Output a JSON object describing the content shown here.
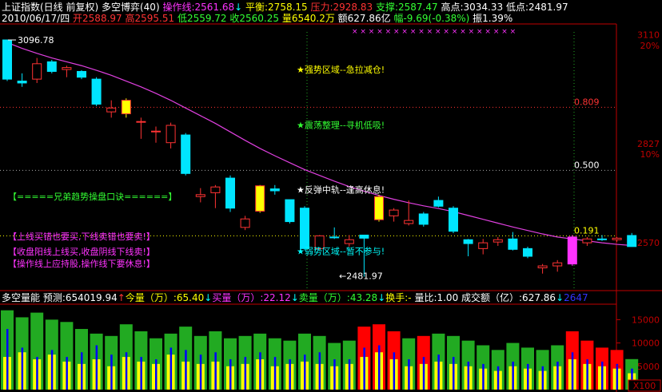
{
  "colors": {
    "bg": "#000000",
    "up": "#ff3333",
    "down": "#00e5ff",
    "ma": "#e040e0",
    "text_white": "#ffffff",
    "text_yellow": "#ffff00",
    "text_green": "#33ff33",
    "text_magenta": "#ff33ff",
    "text_cyan": "#00ffff",
    "text_red": "#ff3333",
    "axis_red": "#c00000",
    "vol_green": "#22aa22",
    "vol_red": "#ff0000",
    "vol_yellow": "#ffff00",
    "vol_blue": "#0000ff"
  },
  "header": {
    "line1": [
      {
        "text": "上证指数(日线 前复权) 多空博弈(40)",
        "color": "#ffffff"
      },
      {
        "text": " 操作线:2561.68",
        "color": "#ff33ff"
      },
      {
        "text": "↓",
        "color": "#00ffff"
      },
      {
        "text": " 平衡:2758.15",
        "color": "#ffff00"
      },
      {
        "text": " 压力:2928.83",
        "color": "#ff3333"
      },
      {
        "text": " 支撑:2587.47",
        "color": "#33ff33"
      },
      {
        "text": " 高点:3034.33",
        "color": "#ffffff"
      },
      {
        "text": " 低点:2481.97",
        "color": "#ffffff"
      }
    ],
    "line2": [
      {
        "text": "2010/06/17/四",
        "color": "#ffffff"
      },
      {
        "text": " 开2588.97",
        "color": "#ff3333"
      },
      {
        "text": " 高2595.51",
        "color": "#ff3333"
      },
      {
        "text": " 低2559.72",
        "color": "#33ff33"
      },
      {
        "text": " 收2560.25",
        "color": "#33ff33"
      },
      {
        "text": " 量6540.2万",
        "color": "#ffff00"
      },
      {
        "text": " 额627.86亿",
        "color": "#ffffff"
      },
      {
        "text": " 幅-9.69(-0.38%)",
        "color": "#33ff33"
      },
      {
        "text": " 振1.39%",
        "color": "#ffffff"
      }
    ]
  },
  "price_axis": {
    "labels": [
      {
        "text": "3110",
        "price": 3110,
        "color": "#c00000"
      },
      {
        "text": "20%",
        "price": 3082,
        "color": "#c00000"
      },
      {
        "text": "2827",
        "price": 2827,
        "color": "#c00000"
      },
      {
        "text": "10%",
        "price": 2800,
        "color": "#c00000"
      },
      {
        "text": "2570",
        "price": 2570,
        "color": "#c00000"
      }
    ]
  },
  "chart_data": {
    "type": "candlestick",
    "title": "上证指数(日线 前复权)",
    "ylim": [
      2450,
      3130
    ],
    "candles": [
      {
        "o": 3096.78,
        "h": 3096.78,
        "l": 2990,
        "c": 2995
      },
      {
        "o": 2990,
        "h": 3010,
        "l": 2975,
        "c": 2985
      },
      {
        "o": 2995,
        "h": 3050,
        "l": 2985,
        "c": 3035
      },
      {
        "o": 3040,
        "h": 3045,
        "l": 3010,
        "c": 3015
      },
      {
        "o": 3020,
        "h": 3030,
        "l": 3000,
        "c": 3025
      },
      {
        "o": 3015,
        "h": 3018,
        "l": 2995,
        "c": 3000
      },
      {
        "o": 2995,
        "h": 3000,
        "l": 2925,
        "c": 2930
      },
      {
        "o": 2910,
        "h": 2940,
        "l": 2895,
        "c": 2920
      },
      {
        "o": 2940,
        "h": 2945,
        "l": 2895,
        "c": 2905
      },
      {
        "o": 2885,
        "h": 2895,
        "l": 2840,
        "c": 2885
      },
      {
        "o": 2860,
        "h": 2872,
        "l": 2830,
        "c": 2860
      },
      {
        "o": 2830,
        "h": 2882,
        "l": 2815,
        "c": 2875
      },
      {
        "o": 2850,
        "h": 2855,
        "l": 2745,
        "c": 2750
      },
      {
        "o": 2690,
        "h": 2712,
        "l": 2675,
        "c": 2695
      },
      {
        "o": 2700,
        "h": 2720,
        "l": 2660,
        "c": 2715
      },
      {
        "o": 2738,
        "h": 2745,
        "l": 2650,
        "c": 2660
      },
      {
        "o": 2610,
        "h": 2640,
        "l": 2603,
        "c": 2632
      },
      {
        "o": 2652,
        "h": 2720,
        "l": 2648,
        "c": 2718
      },
      {
        "o": 2710,
        "h": 2720,
        "l": 2695,
        "c": 2705
      },
      {
        "o": 2682,
        "h": 2682,
        "l": 2620,
        "c": 2625
      },
      {
        "o": 2660,
        "h": 2665,
        "l": 2550,
        "c": 2555
      },
      {
        "o": 2555,
        "h": 2590,
        "l": 2552,
        "c": 2588
      },
      {
        "o": 2585,
        "h": 2610,
        "l": 2580,
        "c": 2583
      },
      {
        "o": 2568,
        "h": 2590,
        "l": 2560,
        "c": 2578
      },
      {
        "o": 2590,
        "h": 2590,
        "l": 2481.97,
        "c": 2582
      },
      {
        "o": 2630,
        "h": 2695,
        "l": 2625,
        "c": 2690
      },
      {
        "o": 2640,
        "h": 2660,
        "l": 2625,
        "c": 2655
      },
      {
        "o": 2620,
        "h": 2680,
        "l": 2615,
        "c": 2628
      },
      {
        "o": 2645,
        "h": 2650,
        "l": 2612,
        "c": 2618
      },
      {
        "o": 2680,
        "h": 2690,
        "l": 2662,
        "c": 2665
      },
      {
        "o": 2660,
        "h": 2665,
        "l": 2595,
        "c": 2600
      },
      {
        "o": 2578,
        "h": 2580,
        "l": 2535,
        "c": 2568
      },
      {
        "o": 2555,
        "h": 2580,
        "l": 2540,
        "c": 2570
      },
      {
        "o": 2572,
        "h": 2585,
        "l": 2562,
        "c": 2578
      },
      {
        "o": 2580,
        "h": 2598,
        "l": 2550,
        "c": 2553
      },
      {
        "o": 2555,
        "h": 2560,
        "l": 2530,
        "c": 2535
      },
      {
        "o": 2505,
        "h": 2515,
        "l": 2490,
        "c": 2510
      },
      {
        "o": 2510,
        "h": 2525,
        "l": 2495,
        "c": 2518
      },
      {
        "o": 2515,
        "h": 2590,
        "l": 2510,
        "c": 2585
      },
      {
        "o": 2570,
        "h": 2585,
        "l": 2562,
        "c": 2580
      },
      {
        "o": 2580,
        "h": 2590,
        "l": 2575,
        "c": 2578
      },
      {
        "o": 2578,
        "h": 2585,
        "l": 2572,
        "c": 2582
      },
      {
        "o": 2588.97,
        "h": 2595.51,
        "l": 2559.72,
        "c": 2560.25
      }
    ],
    "special": {
      "8": "#ffff00",
      "17": "#ffff00",
      "25": "#ffff00",
      "38": "#ff33ff"
    },
    "ma_line": [
      3090,
      3075,
      3062,
      3050,
      3040,
      3030,
      3018,
      3005,
      2990,
      2975,
      2958,
      2940,
      2920,
      2900,
      2880,
      2858,
      2836,
      2815,
      2796,
      2778,
      2760,
      2745,
      2730,
      2716,
      2704,
      2693,
      2683,
      2674,
      2666,
      2659,
      2651,
      2641,
      2631,
      2621,
      2611,
      2602,
      2593,
      2585,
      2580,
      2575,
      2570,
      2566,
      2563
    ],
    "high_label": "3096.78",
    "low_label": "←2481.97",
    "fib_lines": [
      {
        "label": "0.809",
        "price": 2922,
        "color": "#ff3333"
      },
      {
        "label": "0.500",
        "price": 2758,
        "color": "#ffffff"
      },
      {
        "label": "0.191",
        "price": 2588,
        "color": "#ffff00"
      }
    ],
    "zone_labels": [
      {
        "text": "★强势区域--急拉减仓!",
        "price": 3012,
        "color": "#ffff00"
      },
      {
        "text": "★震荡整理--寻机低吸!",
        "price": 2868,
        "color": "#33ff33"
      },
      {
        "text": "★反弹中轨--逢高休息!",
        "price": 2700,
        "color": "#ffffff"
      },
      {
        "text": "★弱势区域--暂不参与!",
        "price": 2540,
        "color": "#00ffff"
      }
    ],
    "mnemonics": [
      {
        "text": "【=====兄弟趋势操盘口诀======】",
        "color": "#33ff33"
      },
      {
        "text": "【上线买错也要买,下线卖错也要卖!】",
        "color": "#ff33ff"
      },
      {
        "text": "【收盘阳线上线买,收盘阴线下线卖!】",
        "color": "#ff33ff"
      },
      {
        "text": "【操作线上应持股,操作线下要休息!】",
        "color": "#ff33ff"
      }
    ],
    "top_marks": "× × × × × × × × × × × × × × × × × × × ×"
  },
  "volume_panel": {
    "header": [
      {
        "text": "多空量能",
        "color": "#ffffff"
      },
      {
        "text": " 预测:654019.94",
        "color": "#ffffff"
      },
      {
        "text": "↑",
        "color": "#ff3333"
      },
      {
        "text": "今量（万）:65.40",
        "color": "#ffff00"
      },
      {
        "text": "↓",
        "color": "#00ffff"
      },
      {
        "text": "买量（万）:22.12",
        "color": "#ff33ff"
      },
      {
        "text": "↓",
        "color": "#00ffff"
      },
      {
        "text": "卖量（万）:43.28",
        "color": "#33ff33"
      },
      {
        "text": "↓",
        "color": "#00ffff"
      },
      {
        "text": "换手:-",
        "color": "#ffff00"
      },
      {
        "text": " 量比:1.00",
        "color": "#ffffff"
      },
      {
        "text": " 成交额（亿）:627.86",
        "color": "#ffffff"
      },
      {
        "text": "↓",
        "color": "#00ffff"
      },
      {
        "text": "2647",
        "color": "#3333ff"
      }
    ],
    "axis_labels": [
      {
        "text": "15000",
        "value": 15000
      },
      {
        "text": "10000",
        "value": 10000
      },
      {
        "text": "5000",
        "value": 5000
      }
    ],
    "unit": "X100",
    "ymax": 17800,
    "volumes": [
      {
        "v": 17000,
        "c": "green",
        "y": 7000,
        "b": 13000
      },
      {
        "v": 15500,
        "c": "green",
        "y": 8000,
        "b": 9000
      },
      {
        "v": 16500,
        "c": "green",
        "y": 6500,
        "b": 7000
      },
      {
        "v": 15000,
        "c": "green",
        "y": 7500,
        "b": 8500
      },
      {
        "v": 14500,
        "c": "green",
        "y": 6000,
        "b": 7000
      },
      {
        "v": 13000,
        "c": "green",
        "y": 5500,
        "b": 8000
      },
      {
        "v": 12000,
        "c": "green",
        "y": 6500,
        "b": 9500
      },
      {
        "v": 11500,
        "c": "green",
        "y": 5000,
        "b": 7500
      },
      {
        "v": 14000,
        "c": "green",
        "y": 7000,
        "b": 8000
      },
      {
        "v": 12500,
        "c": "green",
        "y": 6000,
        "b": 7000
      },
      {
        "v": 11000,
        "c": "green",
        "y": 5500,
        "b": 6500
      },
      {
        "v": 12000,
        "c": "green",
        "y": 7500,
        "b": 9000
      },
      {
        "v": 13500,
        "c": "green",
        "y": 6000,
        "b": 8500
      },
      {
        "v": 11500,
        "c": "green",
        "y": 5500,
        "b": 7500
      },
      {
        "v": 12500,
        "c": "green",
        "y": 6000,
        "b": 8000
      },
      {
        "v": 11000,
        "c": "green",
        "y": 5000,
        "b": 6500
      },
      {
        "v": 11500,
        "c": "green",
        "y": 5500,
        "b": 7000
      },
      {
        "v": 12000,
        "c": "green",
        "y": 6500,
        "b": 8000
      },
      {
        "v": 11000,
        "c": "green",
        "y": 5000,
        "b": 7000
      },
      {
        "v": 10500,
        "c": "green",
        "y": 5500,
        "b": 6500
      },
      {
        "v": 12000,
        "c": "green",
        "y": 6000,
        "b": 7500
      },
      {
        "v": 11500,
        "c": "green",
        "y": 5500,
        "b": 8000
      },
      {
        "v": 10000,
        "c": "green",
        "y": 5000,
        "b": 6500
      },
      {
        "v": 10500,
        "c": "green",
        "y": 5500,
        "b": 6500
      },
      {
        "v": 13500,
        "c": "red",
        "y": 7000,
        "b": 9000
      },
      {
        "v": 14000,
        "c": "red",
        "y": 8000,
        "b": 9500
      },
      {
        "v": 12500,
        "c": "red",
        "y": 6500,
        "b": 8000
      },
      {
        "v": 11000,
        "c": "green",
        "y": 5000,
        "b": 6500
      },
      {
        "v": 11500,
        "c": "red",
        "y": 5500,
        "b": 7000
      },
      {
        "v": 12000,
        "c": "green",
        "y": 6000,
        "b": 7500
      },
      {
        "v": 11500,
        "c": "green",
        "y": 5500,
        "b": 7000
      },
      {
        "v": 10500,
        "c": "green",
        "y": 5000,
        "b": 6000
      },
      {
        "v": 9500,
        "c": "green",
        "y": 4500,
        "b": 5500
      },
      {
        "v": 8500,
        "c": "green",
        "y": 4000,
        "b": 5000
      },
      {
        "v": 10000,
        "c": "green",
        "y": 5000,
        "b": 6000
      },
      {
        "v": 9000,
        "c": "green",
        "y": 4500,
        "b": 5500
      },
      {
        "v": 8500,
        "c": "green",
        "y": 4000,
        "b": 5000
      },
      {
        "v": 9500,
        "c": "green",
        "y": 5000,
        "b": 6000
      },
      {
        "v": 12500,
        "c": "red",
        "y": 6500,
        "b": 8000
      },
      {
        "v": 10500,
        "c": "red",
        "y": 5500,
        "b": 6500
      },
      {
        "v": 9000,
        "c": "red",
        "y": 5000,
        "b": 6000
      },
      {
        "v": 8500,
        "c": "red",
        "y": 4500,
        "b": 5500
      },
      {
        "v": 6540,
        "c": "green",
        "y": 3500,
        "b": 4500
      }
    ]
  }
}
